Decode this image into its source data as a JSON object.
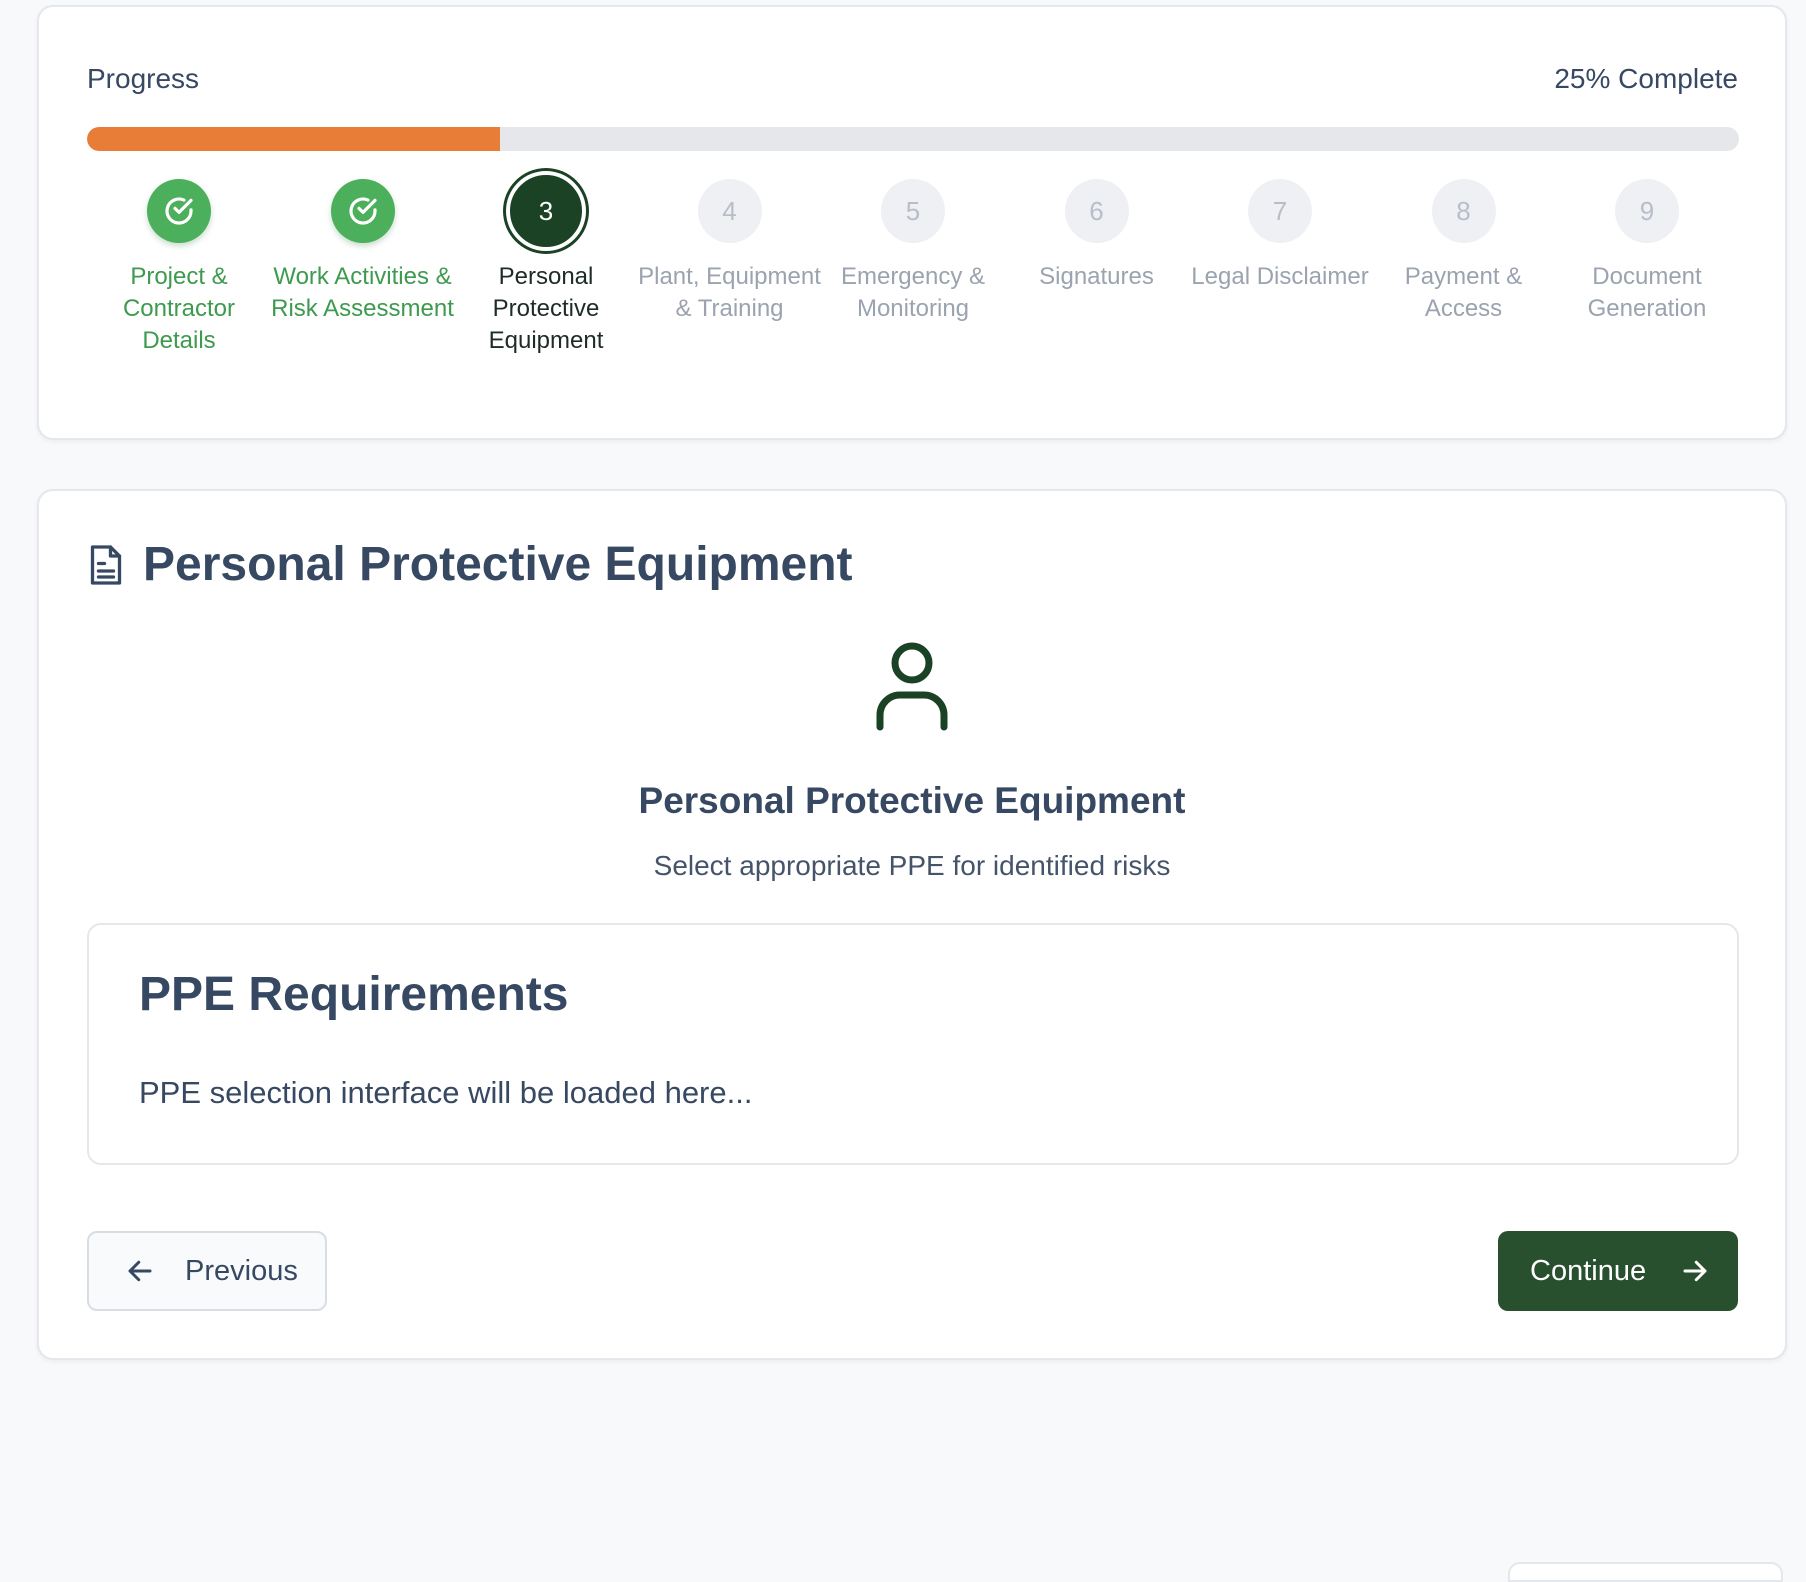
{
  "progress": {
    "title": "Progress",
    "value_text": "25% Complete",
    "fraction": 0.25,
    "fill_color": "#e87d37"
  },
  "steps": [
    {
      "label": "Project & Contractor Details",
      "state": "done",
      "icon": "check-circle-icon"
    },
    {
      "label": "Work Activities & Risk Assessment",
      "state": "done",
      "icon": "check-circle-icon"
    },
    {
      "number": "3",
      "label": "Personal Protective Equipment",
      "state": "active"
    },
    {
      "number": "4",
      "label": "Plant, Equipment & Training",
      "state": "todo"
    },
    {
      "number": "5",
      "label": "Emergency & Monitoring",
      "state": "todo"
    },
    {
      "number": "6",
      "label": "Signatures",
      "state": "todo"
    },
    {
      "number": "7",
      "label": "Legal Disclaimer",
      "state": "todo"
    },
    {
      "number": "8",
      "label": "Payment & Access",
      "state": "todo"
    },
    {
      "number": "9",
      "label": "Document Generation",
      "state": "todo"
    }
  ],
  "section": {
    "title": "Personal Protective Equipment",
    "icon": "document-icon",
    "hero_icon": "user-icon",
    "hero_title": "Personal Protective Equipment",
    "hero_subtitle": "Select appropriate PPE for identified risks"
  },
  "requirements": {
    "title": "PPE Requirements",
    "text": "PPE selection interface will be loaded here..."
  },
  "nav": {
    "previous_label": "Previous",
    "continue_label": "Continue"
  },
  "colors": {
    "done": "#4caf5c",
    "active": "#1b4225",
    "continue_bg": "#28502f"
  }
}
